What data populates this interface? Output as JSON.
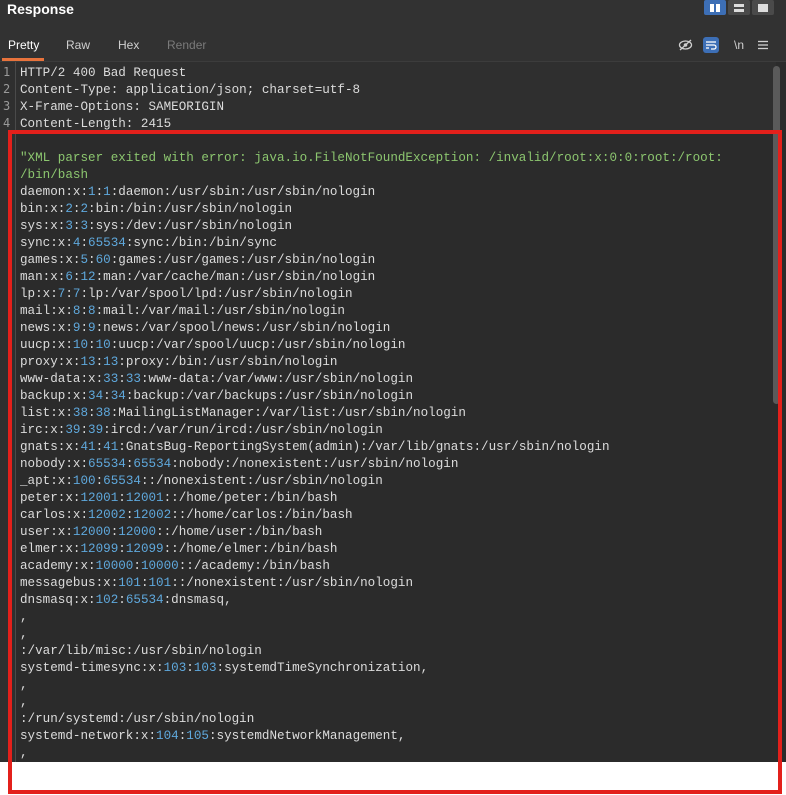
{
  "window": {
    "title": "Response"
  },
  "layout_toggles": [
    {
      "name": "side-by-side-icon",
      "active": true
    },
    {
      "name": "stacked-icon",
      "active": false
    },
    {
      "name": "single-pane-icon",
      "active": false
    }
  ],
  "tabs": [
    {
      "label": "Pretty",
      "active": true
    },
    {
      "label": "Raw",
      "active": false
    },
    {
      "label": "Hex",
      "active": false
    },
    {
      "label": "Render",
      "active": false,
      "disabled": true
    }
  ],
  "toolbar": {
    "hide_icon": "eye-slash-icon",
    "wrap_icon": "wrap-lines-icon",
    "newline_label": "\\n",
    "menu_icon": "hamburger-menu-icon"
  },
  "editor": {
    "line_numbers": [
      "1",
      "2",
      "3",
      "4"
    ],
    "headers": [
      "HTTP/2 400 Bad Request",
      "Content-Type: application/json; charset=utf-8",
      "X-Frame-Options: SAMEORIGIN",
      "Content-Length: 2415"
    ],
    "body_lines": [
      [
        {
          "t": "\"XML parser exited with error: java.io.FileNotFoundException: /invalid/root:x:0:0:root:/root:",
          "c": "s"
        }
      ],
      [
        {
          "t": "/bin/bash",
          "c": "s"
        }
      ],
      [
        {
          "t": "daemon:x:"
        },
        {
          "t": "1",
          "c": "n"
        },
        {
          "t": ":"
        },
        {
          "t": "1",
          "c": "n"
        },
        {
          "t": ":daemon:/usr/sbin:/usr/sbin/nologin"
        }
      ],
      [
        {
          "t": "bin:x:"
        },
        {
          "t": "2",
          "c": "n"
        },
        {
          "t": ":"
        },
        {
          "t": "2",
          "c": "n"
        },
        {
          "t": ":bin:/bin:/usr/sbin/nologin"
        }
      ],
      [
        {
          "t": "sys:x:"
        },
        {
          "t": "3",
          "c": "n"
        },
        {
          "t": ":"
        },
        {
          "t": "3",
          "c": "n"
        },
        {
          "t": ":sys:/dev:/usr/sbin/nologin"
        }
      ],
      [
        {
          "t": "sync:x:"
        },
        {
          "t": "4",
          "c": "n"
        },
        {
          "t": ":"
        },
        {
          "t": "65534",
          "c": "n"
        },
        {
          "t": ":sync:/bin:/bin/sync"
        }
      ],
      [
        {
          "t": "games:x:"
        },
        {
          "t": "5",
          "c": "n"
        },
        {
          "t": ":"
        },
        {
          "t": "60",
          "c": "n"
        },
        {
          "t": ":games:/usr/games:/usr/sbin/nologin"
        }
      ],
      [
        {
          "t": "man:x:"
        },
        {
          "t": "6",
          "c": "n"
        },
        {
          "t": ":"
        },
        {
          "t": "12",
          "c": "n"
        },
        {
          "t": ":man:/var/cache/man:/usr/sbin/nologin"
        }
      ],
      [
        {
          "t": "lp:x:"
        },
        {
          "t": "7",
          "c": "n"
        },
        {
          "t": ":"
        },
        {
          "t": "7",
          "c": "n"
        },
        {
          "t": ":lp:/var/spool/lpd:/usr/sbin/nologin"
        }
      ],
      [
        {
          "t": "mail:x:"
        },
        {
          "t": "8",
          "c": "n"
        },
        {
          "t": ":"
        },
        {
          "t": "8",
          "c": "n"
        },
        {
          "t": ":mail:/var/mail:/usr/sbin/nologin"
        }
      ],
      [
        {
          "t": "news:x:"
        },
        {
          "t": "9",
          "c": "n"
        },
        {
          "t": ":"
        },
        {
          "t": "9",
          "c": "n"
        },
        {
          "t": ":news:/var/spool/news:/usr/sbin/nologin"
        }
      ],
      [
        {
          "t": "uucp:x:"
        },
        {
          "t": "10",
          "c": "n"
        },
        {
          "t": ":"
        },
        {
          "t": "10",
          "c": "n"
        },
        {
          "t": ":uucp:/var/spool/uucp:/usr/sbin/nologin"
        }
      ],
      [
        {
          "t": "proxy:x:"
        },
        {
          "t": "13",
          "c": "n"
        },
        {
          "t": ":"
        },
        {
          "t": "13",
          "c": "n"
        },
        {
          "t": ":proxy:/bin:/usr/sbin/nologin"
        }
      ],
      [
        {
          "t": "www-data:x:"
        },
        {
          "t": "33",
          "c": "n"
        },
        {
          "t": ":"
        },
        {
          "t": "33",
          "c": "n"
        },
        {
          "t": ":www-data:/var/www:/usr/sbin/nologin"
        }
      ],
      [
        {
          "t": "backup:x:"
        },
        {
          "t": "34",
          "c": "n"
        },
        {
          "t": ":"
        },
        {
          "t": "34",
          "c": "n"
        },
        {
          "t": ":backup:/var/backups:/usr/sbin/nologin"
        }
      ],
      [
        {
          "t": "list:x:"
        },
        {
          "t": "38",
          "c": "n"
        },
        {
          "t": ":"
        },
        {
          "t": "38",
          "c": "n"
        },
        {
          "t": ":MailingListManager:/var/list:/usr/sbin/nologin"
        }
      ],
      [
        {
          "t": "irc:x:"
        },
        {
          "t": "39",
          "c": "n"
        },
        {
          "t": ":"
        },
        {
          "t": "39",
          "c": "n"
        },
        {
          "t": ":ircd:/var/run/ircd:/usr/sbin/nologin"
        }
      ],
      [
        {
          "t": "gnats:x:"
        },
        {
          "t": "41",
          "c": "n"
        },
        {
          "t": ":"
        },
        {
          "t": "41",
          "c": "n"
        },
        {
          "t": ":GnatsBug-ReportingSystem(admin):/var/lib/gnats:/usr/sbin/nologin"
        }
      ],
      [
        {
          "t": "nobody:x:"
        },
        {
          "t": "65534",
          "c": "n"
        },
        {
          "t": ":"
        },
        {
          "t": "65534",
          "c": "n"
        },
        {
          "t": ":nobody:/nonexistent:/usr/sbin/nologin"
        }
      ],
      [
        {
          "t": "_apt:x:"
        },
        {
          "t": "100",
          "c": "n"
        },
        {
          "t": ":"
        },
        {
          "t": "65534",
          "c": "n"
        },
        {
          "t": "::/nonexistent:/usr/sbin/nologin"
        }
      ],
      [
        {
          "t": "peter:x:"
        },
        {
          "t": "12001",
          "c": "n"
        },
        {
          "t": ":"
        },
        {
          "t": "12001",
          "c": "n"
        },
        {
          "t": "::/home/peter:/bin/bash"
        }
      ],
      [
        {
          "t": "carlos:x:"
        },
        {
          "t": "12002",
          "c": "n"
        },
        {
          "t": ":"
        },
        {
          "t": "12002",
          "c": "n"
        },
        {
          "t": "::/home/carlos:/bin/bash"
        }
      ],
      [
        {
          "t": "user:x:"
        },
        {
          "t": "12000",
          "c": "n"
        },
        {
          "t": ":"
        },
        {
          "t": "12000",
          "c": "n"
        },
        {
          "t": "::/home/user:/bin/bash"
        }
      ],
      [
        {
          "t": "elmer:x:"
        },
        {
          "t": "12099",
          "c": "n"
        },
        {
          "t": ":"
        },
        {
          "t": "12099",
          "c": "n"
        },
        {
          "t": "::/home/elmer:/bin/bash"
        }
      ],
      [
        {
          "t": "academy:x:"
        },
        {
          "t": "10000",
          "c": "n"
        },
        {
          "t": ":"
        },
        {
          "t": "10000",
          "c": "n"
        },
        {
          "t": "::/academy:/bin/bash"
        }
      ],
      [
        {
          "t": "messagebus:x:"
        },
        {
          "t": "101",
          "c": "n"
        },
        {
          "t": ":"
        },
        {
          "t": "101",
          "c": "n"
        },
        {
          "t": "::/nonexistent:/usr/sbin/nologin"
        }
      ],
      [
        {
          "t": "dnsmasq:x:"
        },
        {
          "t": "102",
          "c": "n"
        },
        {
          "t": ":"
        },
        {
          "t": "65534",
          "c": "n"
        },
        {
          "t": ":dnsmasq,"
        }
      ],
      [
        {
          "t": ","
        }
      ],
      [
        {
          "t": ","
        }
      ],
      [
        {
          "t": ":/var/lib/misc:/usr/sbin/nologin"
        }
      ],
      [
        {
          "t": "systemd-timesync:x:"
        },
        {
          "t": "103",
          "c": "n"
        },
        {
          "t": ":"
        },
        {
          "t": "103",
          "c": "n"
        },
        {
          "t": ":systemdTimeSynchronization,"
        }
      ],
      [
        {
          "t": ","
        }
      ],
      [
        {
          "t": ","
        }
      ],
      [
        {
          "t": ":/run/systemd:/usr/sbin/nologin"
        }
      ],
      [
        {
          "t": "systemd-network:x:"
        },
        {
          "t": "104",
          "c": "n"
        },
        {
          "t": ":"
        },
        {
          "t": "105",
          "c": "n"
        },
        {
          "t": ":systemdNetworkManagement,"
        }
      ],
      [
        {
          "t": ","
        }
      ]
    ]
  },
  "scrollbar": {
    "position": 0,
    "visible_fraction": 0.49
  },
  "colors": {
    "highlight": "#e3201b",
    "string": "#8cc66f",
    "number": "#5fa8dc",
    "accent": "#e8733c"
  }
}
